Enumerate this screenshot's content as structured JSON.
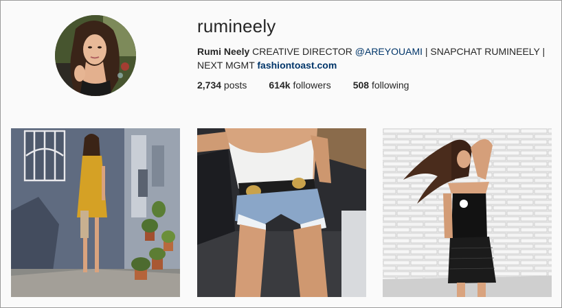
{
  "profile": {
    "username": "rumineely",
    "full_name": "Rumi Neely",
    "bio_text": " CREATIVE DIRECTOR ",
    "bio_mention": "@AREYOUAMI",
    "bio_rest": " | SNAPCHAT RUMINEELY | NEXT MGMT ",
    "website": "fashiontoast.com"
  },
  "stats": {
    "posts_count": "2,734",
    "posts_label": " posts",
    "followers_count": "614k",
    "followers_label": " followers",
    "following_count": "508",
    "following_label": " following"
  },
  "colors": {
    "link": "#003569",
    "text": "#262626",
    "background": "#fafafa"
  },
  "posts": [
    {
      "subject": "woman in mustard dress by blue wall with potted plants"
    },
    {
      "subject": "white tank top and denim shorts with belt"
    },
    {
      "subject": "woman in black top and leather skirt against white brick wall"
    }
  ]
}
